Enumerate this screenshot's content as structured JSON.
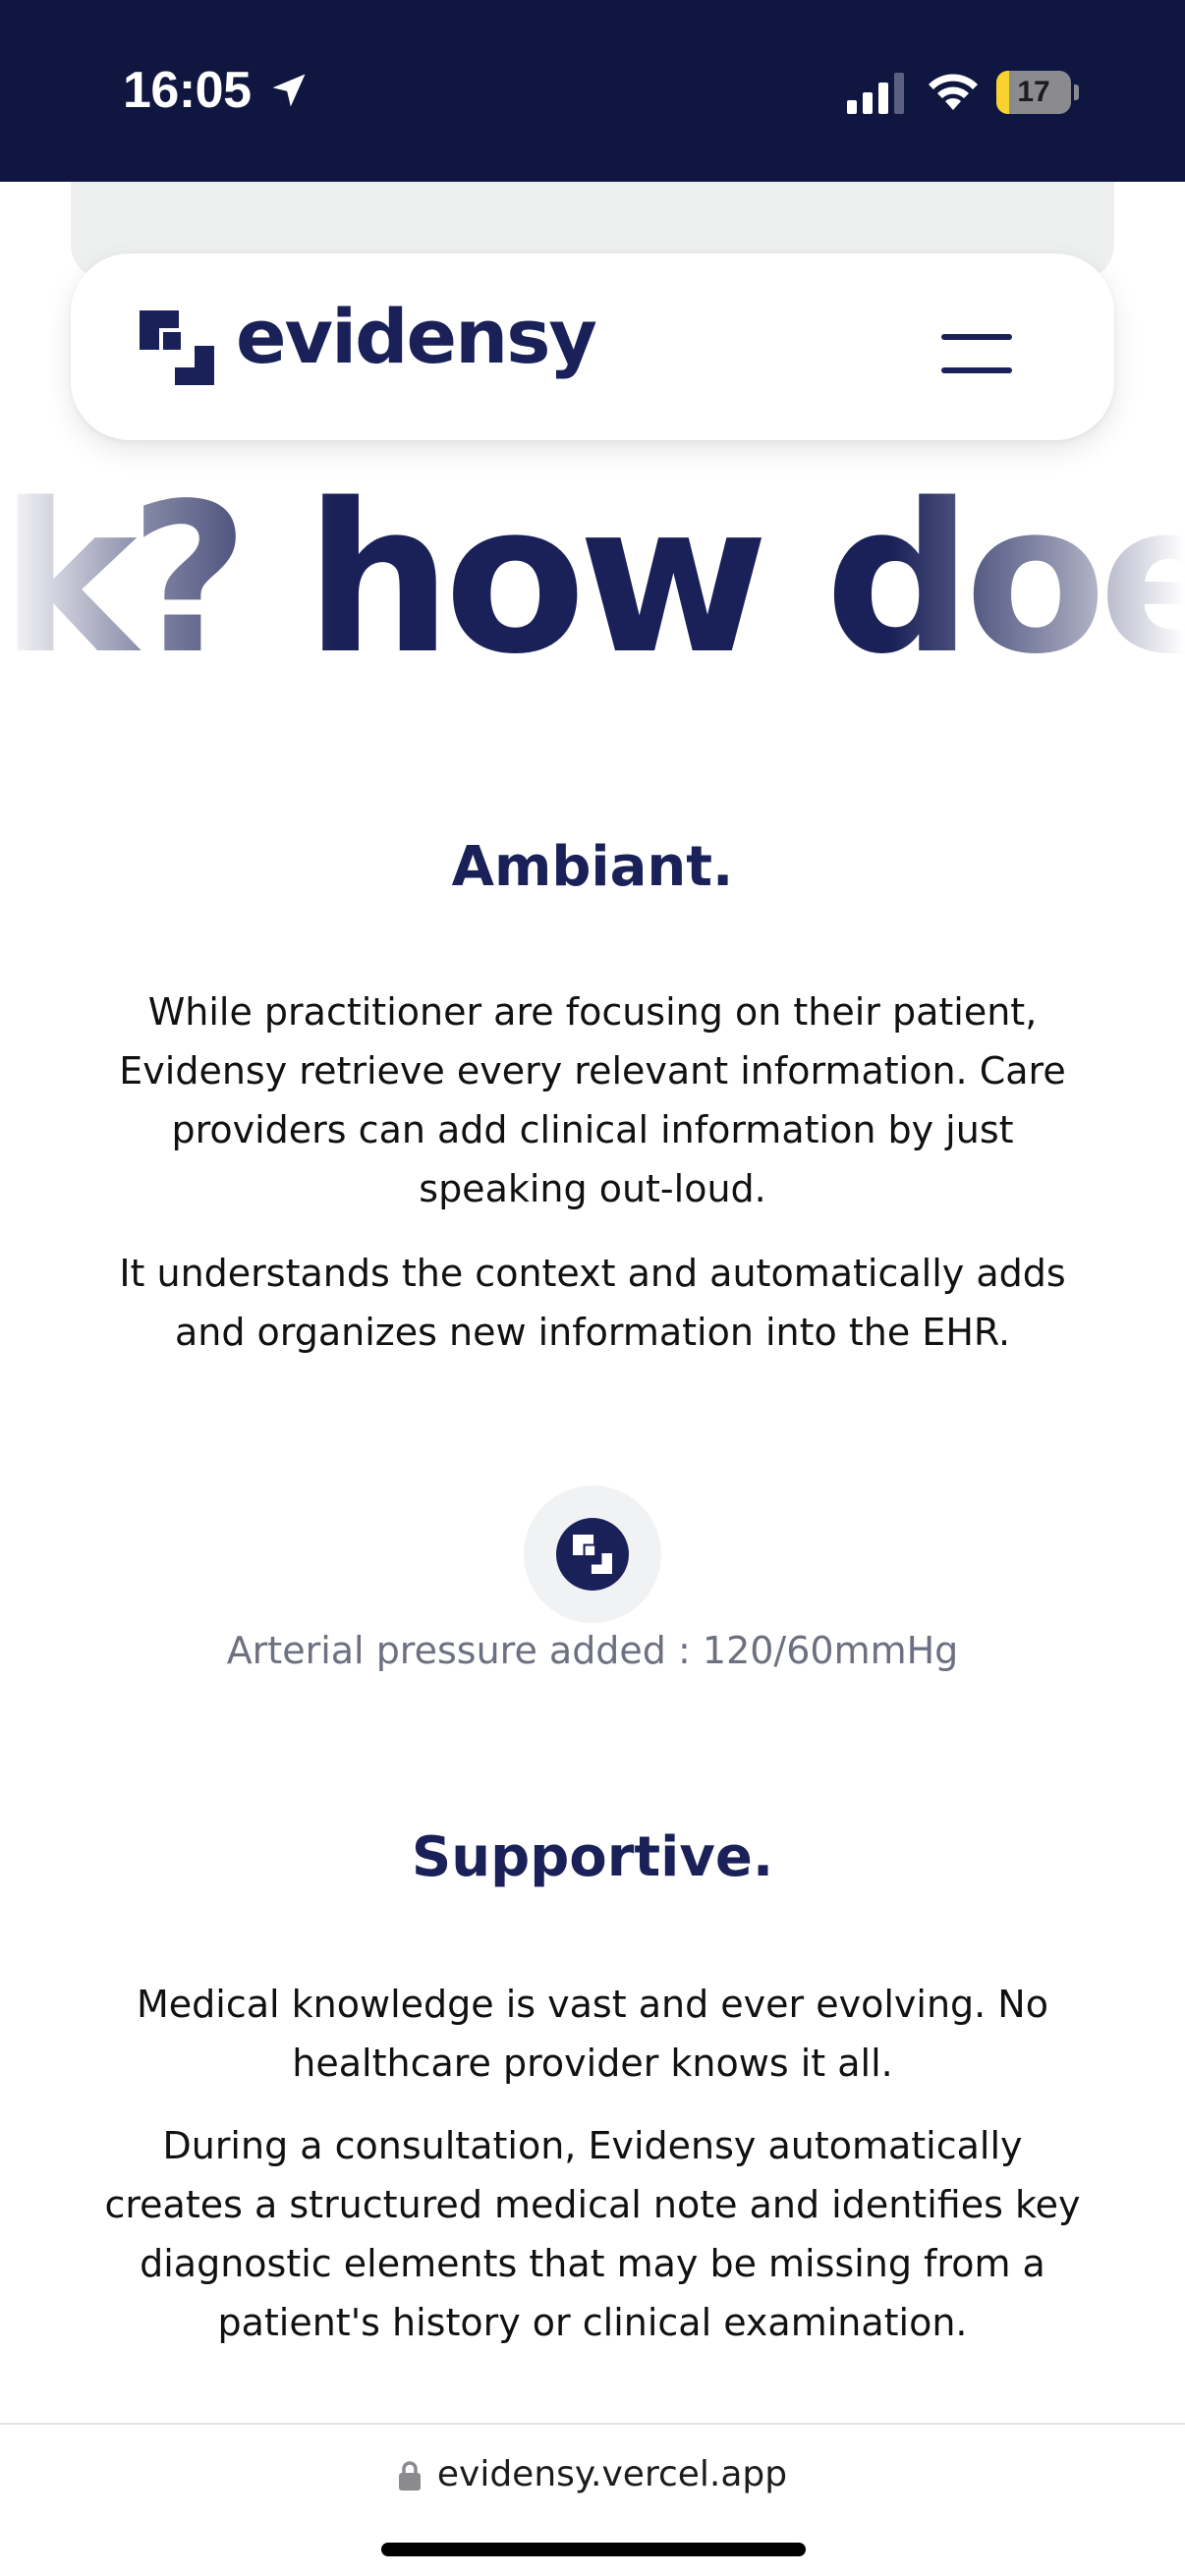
{
  "status_bar": {
    "time": "16:05",
    "battery_level": "17",
    "battery_fraction": 0.17,
    "icons": [
      "location-arrow-icon",
      "cellular-signal-icon",
      "wifi-icon",
      "battery-icon"
    ]
  },
  "header": {
    "brand": "evidensy",
    "logo_icon": "evidensy-logo-icon",
    "menu_icon": "hamburger-menu-icon"
  },
  "marquee": {
    "text": "k?  how doe"
  },
  "sections": [
    {
      "title": "Ambiant.",
      "paragraphs": [
        "While practitioner are focusing on their patient, Evidensy retrieve every relevant information. Care providers can add clinical information by just speaking out-loud.",
        "It understands the context and automatically adds and organizes new information into the EHR."
      ],
      "badge_icon": "evidensy-ai-icon",
      "caption": "Arterial pressure added : 120/60mmHg"
    },
    {
      "title": "Supportive.",
      "paragraphs": [
        "Medical knowledge is vast and ever evolving. No healthcare provider knows it all.",
        "During a consultation, Evidensy automatically creates a structured medical note and identifies key diagnostic elements that may be missing from a patient's history or clinical examination."
      ]
    }
  ],
  "browser": {
    "url": "evidensy.vercel.app",
    "lock_icon": "lock-icon"
  },
  "colors": {
    "status_bar_bg": "#0f1640",
    "brand_navy": "#1a2158",
    "caption_gray": "#6c7080",
    "battery_yellow": "#f8d330"
  }
}
